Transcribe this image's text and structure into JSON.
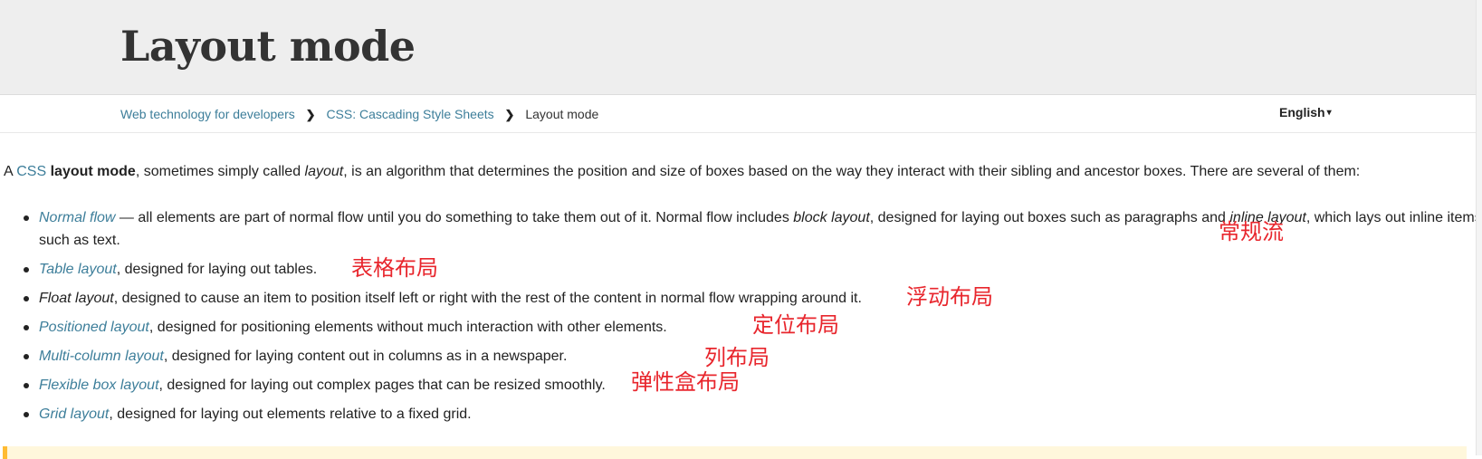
{
  "header": {
    "title": "Layout mode"
  },
  "breadcrumb": {
    "items": [
      "Web technology for developers",
      "CSS: Cascading Style Sheets"
    ],
    "current": "Layout mode",
    "separator": "❯"
  },
  "language": {
    "label": "English",
    "caret": "▾"
  },
  "intro": {
    "a": "A ",
    "link": "CSS",
    "strong": "layout mode",
    "t1": ", sometimes simply called ",
    "em": "layout",
    "t2": ", is an algorithm that determines the position and size of boxes based on the way they interact with their sibling and ancestor boxes. There are several of them:"
  },
  "modes": {
    "normal": {
      "link": "Normal flow",
      "t1": " — all elements are part of normal flow until you do something to take them out of it. Normal flow includes ",
      "em1": "block layout",
      "t2": ", designed for laying out boxes such as paragraphs and ",
      "em2": "inline layout",
      "t3": ", which lays out inline items such as text."
    },
    "table": {
      "link": "Table layout",
      "t": ", designed for laying out tables."
    },
    "float": {
      "em": "Float layout",
      "t": ", designed to cause an item to position itself left or right with the rest of the content in normal flow wrapping around it."
    },
    "positioned": {
      "link": "Positioned layout",
      "t": ", designed for positioning elements without much interaction with other elements."
    },
    "multicol": {
      "link": "Multi-column layout",
      "t": ", designed for laying content out in columns as in a newspaper."
    },
    "flex": {
      "link": "Flexible box layout",
      "t": ", designed for laying out complex pages that can be resized smoothly."
    },
    "grid": {
      "link": "Grid layout",
      "t": ", designed for laying out elements relative to a fixed grid."
    }
  },
  "annotations": {
    "normal": "常规流",
    "table": "表格布局",
    "float": "浮动布局",
    "positioned": "定位布局",
    "multicol": "列布局",
    "flex": "弹性盒布局"
  },
  "colors": {
    "link": "#3d7e9a",
    "annotation": "#e8262d",
    "header_bg": "#eeeeee",
    "note_border": "#ffbb33"
  }
}
